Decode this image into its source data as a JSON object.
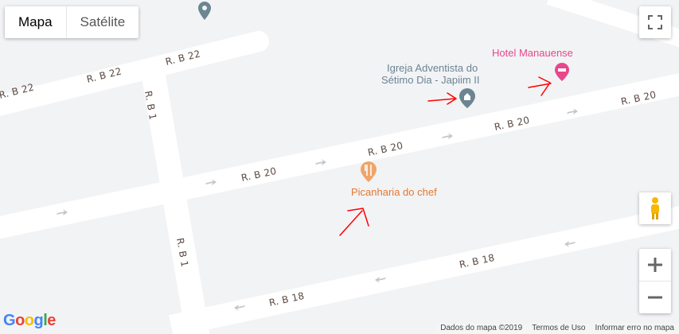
{
  "map_type": {
    "map_label": "Mapa",
    "satellite_label": "Satélite",
    "selected": "Mapa"
  },
  "streets": {
    "b22_left": "R. B 22",
    "b22_mid": "R. B 22",
    "b22_right": "R. B 22",
    "b1_top": "R. B 1",
    "b1_bottom": "R. B 1",
    "b20_left": "R. B 20",
    "b20_mid": "R. B 20",
    "b20_right": "R. B 20",
    "b20_far": "R. B 20",
    "b18_left": "R. B 18",
    "b18_right": "R. B 18"
  },
  "pois": {
    "hotel": {
      "label": "Hotel Manauense",
      "color": "#e8478b"
    },
    "church": {
      "line1": "Igreja Adventista do",
      "line2": "Sétimo Dia - Japiim II",
      "color": "#6b8592"
    },
    "restaurant": {
      "label": "Picanharia do chef",
      "color": "#e3792f"
    }
  },
  "footer": {
    "map_data": "Dados do mapa ©2019",
    "terms": "Termos de Uso",
    "report": "Informar erro no mapa"
  },
  "logo": {
    "letters": [
      "G",
      "o",
      "o",
      "g",
      "l",
      "e"
    ],
    "colors": [
      "#4285f4",
      "#ea4335",
      "#fbbc05",
      "#4285f4",
      "#34a853",
      "#ea4335"
    ]
  },
  "colors": {
    "road": "#ffffff",
    "land": "#f2f3f5",
    "annotation": "#ff0000"
  },
  "icons": {
    "fullscreen": "fullscreen-icon",
    "pegman": "pegman-icon",
    "zoom_in": "plus-icon",
    "zoom_out": "minus-icon"
  }
}
